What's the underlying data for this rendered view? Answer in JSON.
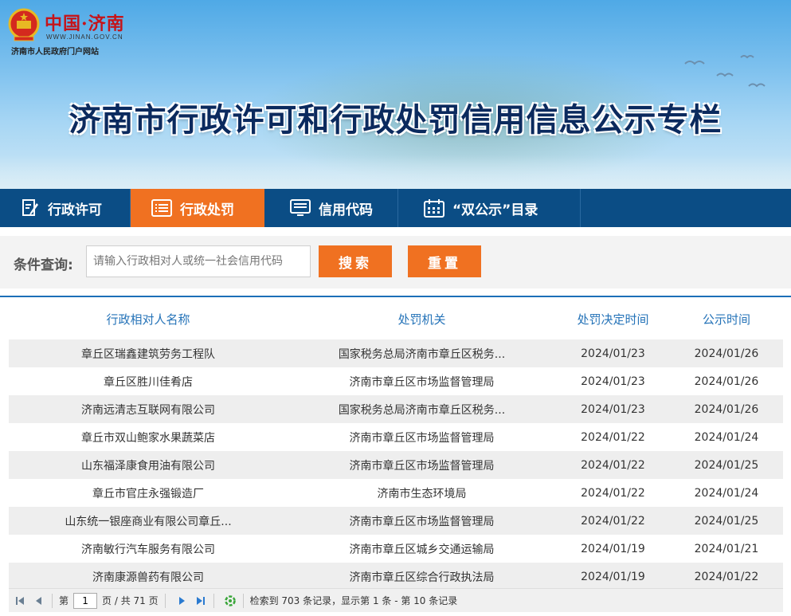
{
  "header": {
    "logo_cn": "中国·济南",
    "logo_url": "WWW.JINAN.GOV.CN",
    "logo_sub": "济南市人民政府门户网站",
    "title": "济南市行政许可和行政处罚信用信息公示专栏"
  },
  "nav": {
    "items": [
      {
        "label": "行政许可",
        "icon": "document-edit-icon"
      },
      {
        "label": "行政处罚",
        "icon": "list-icon"
      },
      {
        "label": "信用代码",
        "icon": "monitor-list-icon"
      },
      {
        "label": "“双公示”目录",
        "icon": "calendar-icon"
      }
    ],
    "active_index": 1
  },
  "search": {
    "label": "条件查询:",
    "placeholder": "请输入行政相对人或统一社会信用代码",
    "value": "",
    "search_label": "搜索",
    "reset_label": "重置"
  },
  "table": {
    "columns": [
      "行政相对人名称",
      "处罚机关",
      "处罚决定时间",
      "公示时间"
    ],
    "rows": [
      [
        "章丘区瑞鑫建筑劳务工程队",
        "国家税务总局济南市章丘区税务...",
        "2024/01/23",
        "2024/01/26"
      ],
      [
        "章丘区胜川佳肴店",
        "济南市章丘区市场监督管理局",
        "2024/01/23",
        "2024/01/26"
      ],
      [
        "济南远清志互联网有限公司",
        "国家税务总局济南市章丘区税务...",
        "2024/01/23",
        "2024/01/26"
      ],
      [
        "章丘市双山鲍家水果蔬菜店",
        "济南市章丘区市场监督管理局",
        "2024/01/22",
        "2024/01/24"
      ],
      [
        "山东福泽康食用油有限公司",
        "济南市章丘区市场监督管理局",
        "2024/01/22",
        "2024/01/25"
      ],
      [
        "章丘市官庄永强锻造厂",
        "济南市生态环境局",
        "2024/01/22",
        "2024/01/24"
      ],
      [
        "山东统一银座商业有限公司章丘...",
        "济南市章丘区市场监督管理局",
        "2024/01/22",
        "2024/01/25"
      ],
      [
        "济南敏行汽车服务有限公司",
        "济南市章丘区城乡交通运输局",
        "2024/01/19",
        "2024/01/21"
      ],
      [
        "济南康源兽药有限公司",
        "济南市章丘区综合行政执法局",
        "2024/01/19",
        "2024/01/22"
      ]
    ]
  },
  "pager": {
    "page_prefix": "第",
    "page_value": "1",
    "page_suffix": "页 / 共 71 页",
    "summary": "检索到 703 条记录，显示第 1 条 - 第 10 条记录"
  },
  "colors": {
    "nav_bg": "#0b4d85",
    "accent": "#f07121",
    "header_link": "#2573b8",
    "title": "#0b2a5e"
  }
}
